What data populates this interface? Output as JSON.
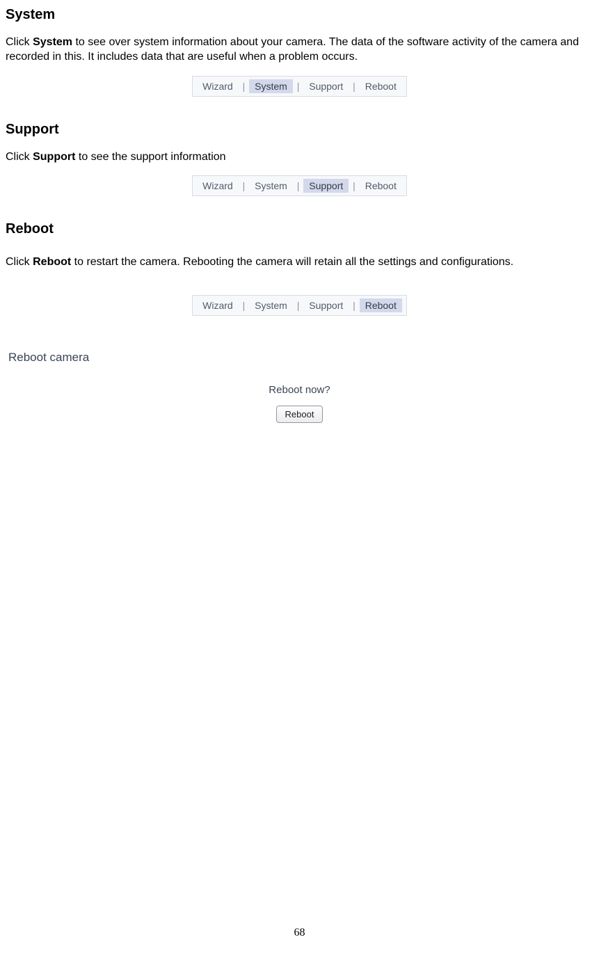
{
  "sections": {
    "system": {
      "heading": "System",
      "para_prefix": "Click ",
      "para_bold": "System",
      "para_suffix": " to see over system information about your camera. The data of the software activity of the camera and recorded in this. It includes data that are useful when a problem occurs."
    },
    "support": {
      "heading": "Support",
      "para_prefix": "Click ",
      "para_bold": "Support",
      "para_suffix": " to see the support information"
    },
    "reboot": {
      "heading": "Reboot",
      "para_prefix": "Click ",
      "para_bold": "Reboot",
      "para_suffix": " to restart the camera. Rebooting the camera will retain all the settings and configurations."
    }
  },
  "nav": {
    "items": [
      "Wizard",
      "System",
      "Support",
      "Reboot"
    ],
    "sep": "|"
  },
  "reboot_panel": {
    "title": "Reboot camera",
    "question": "Reboot now?",
    "button": "Reboot"
  },
  "page_number": "68"
}
